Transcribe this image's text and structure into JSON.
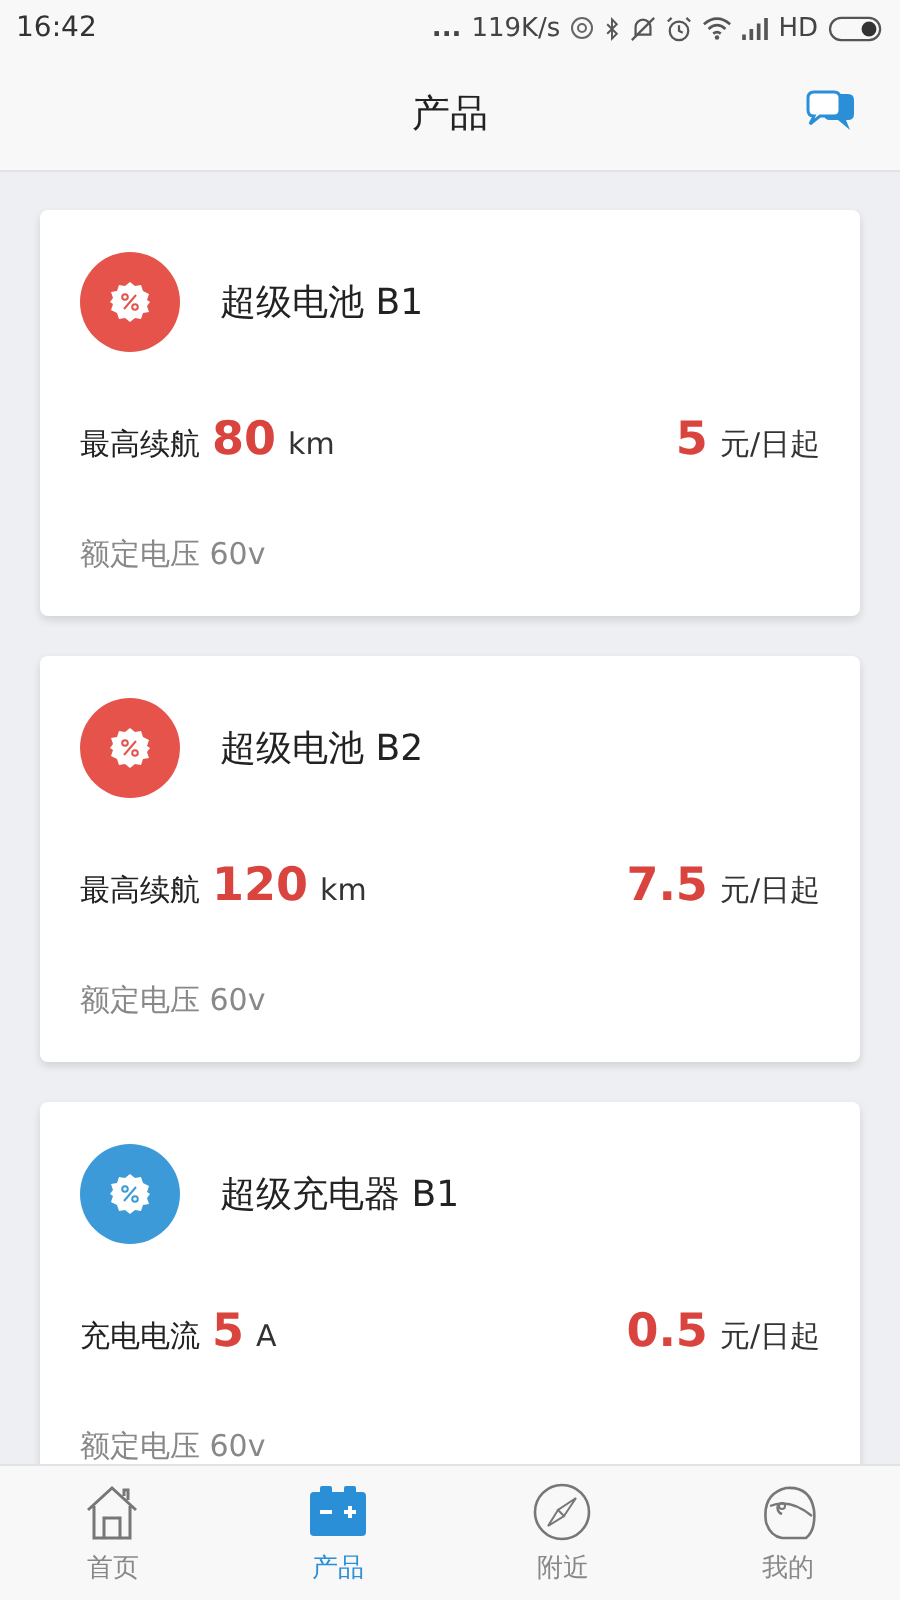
{
  "status_bar": {
    "time": "16:42",
    "more": "...",
    "speed": "119K/s",
    "network": "HD"
  },
  "header": {
    "title": "产品"
  },
  "products": [
    {
      "name": "超级电池 B1",
      "color": "#e5534b",
      "spec_label": "最高续航",
      "spec_value": "80",
      "spec_unit": "km",
      "price_value": "5",
      "price_unit": "元/日起",
      "rated": "额定电压 60v"
    },
    {
      "name": "超级电池 B2",
      "color": "#e5534b",
      "spec_label": "最高续航",
      "spec_value": "120",
      "spec_unit": "km",
      "price_value": "7.5",
      "price_unit": "元/日起",
      "rated": "额定电压 60v"
    },
    {
      "name": "超级充电器 B1",
      "color": "#3d9ad8",
      "spec_label": "充电电流",
      "spec_value": "5",
      "spec_unit": "A",
      "price_value": "0.5",
      "price_unit": "元/日起",
      "rated": "额定电压 60v"
    }
  ],
  "nav": [
    {
      "label": "首页",
      "kind": "home",
      "selected": false
    },
    {
      "label": "产品",
      "kind": "battery",
      "selected": true
    },
    {
      "label": "附近",
      "kind": "compass",
      "selected": false
    },
    {
      "label": "我的",
      "kind": "helmet",
      "selected": false
    }
  ]
}
